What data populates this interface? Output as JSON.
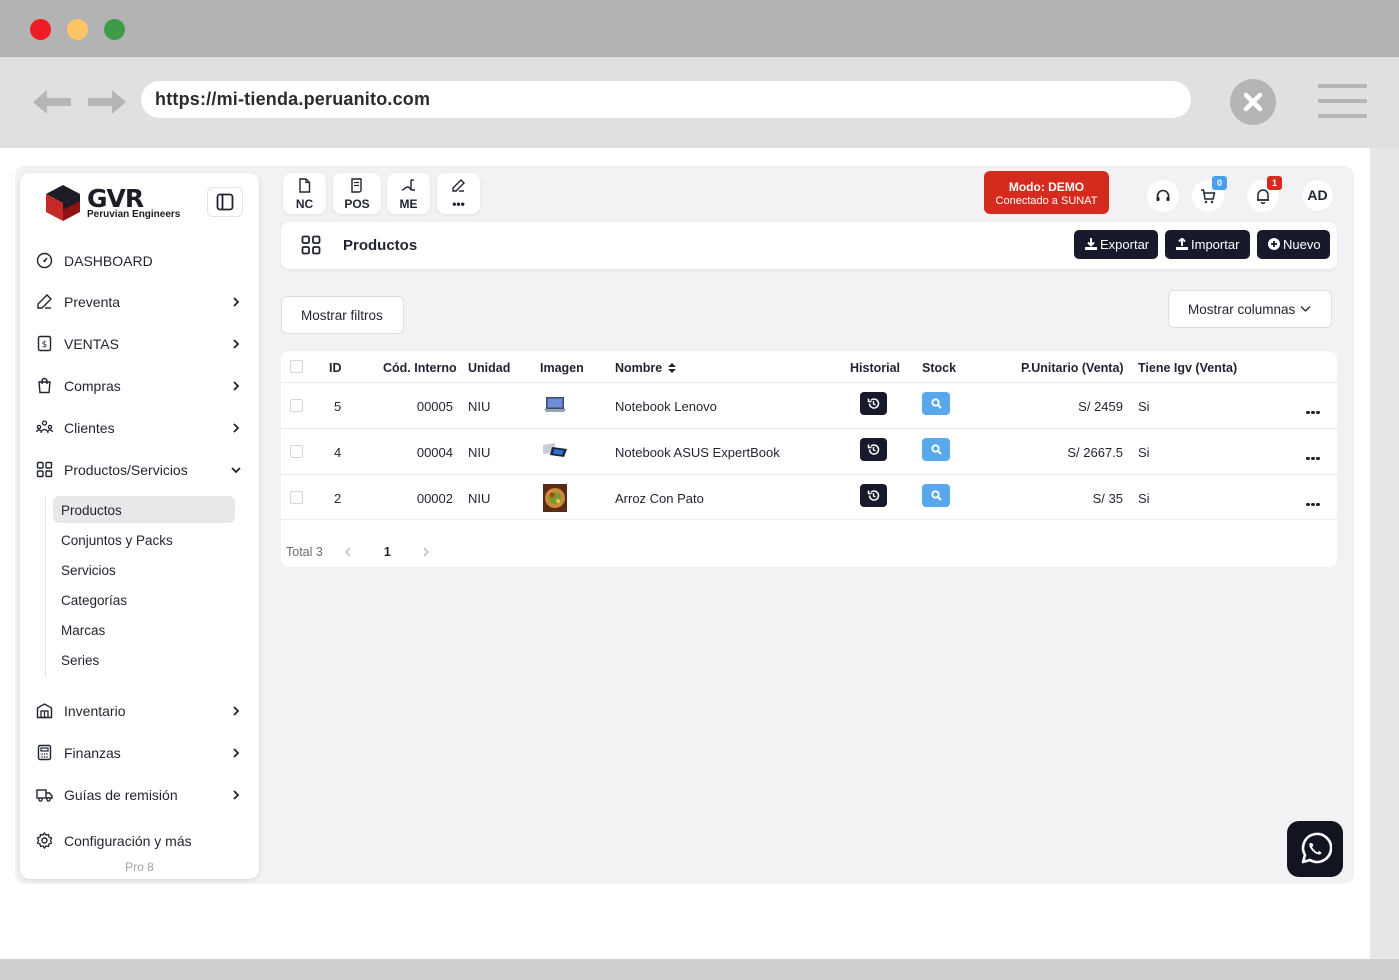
{
  "browser": {
    "url": "https://mi-tienda.peruanito.com",
    "traffic_lights": [
      "#ee1c25",
      "#fdc566",
      "#3e9b4a"
    ]
  },
  "sidebar": {
    "logo_title": "GVR",
    "logo_subtitle": "Peruvian Engineers",
    "items": [
      {
        "label": "DASHBOARD",
        "icon": "dashboard-gauge-icon",
        "chevron": false
      },
      {
        "label": "Preventa",
        "icon": "edit-icon",
        "chevron": true
      },
      {
        "label": "VENTAS",
        "icon": "receipt-icon",
        "chevron": true
      },
      {
        "label": "Compras",
        "icon": "shopping-bag-icon",
        "chevron": true
      },
      {
        "label": "Clientes",
        "icon": "users-icon",
        "chevron": true
      },
      {
        "label": "Productos/Servicios",
        "icon": "grid-icon",
        "chevron": "down"
      }
    ],
    "subitems": [
      {
        "label": "Productos",
        "active": true
      },
      {
        "label": "Conjuntos y Packs"
      },
      {
        "label": "Servicios"
      },
      {
        "label": "Categorías"
      },
      {
        "label": "Marcas"
      },
      {
        "label": "Series"
      }
    ],
    "bottom_items": [
      {
        "label": "Inventario",
        "icon": "warehouse-icon",
        "chevron": true
      },
      {
        "label": "Finanzas",
        "icon": "calculator-icon",
        "chevron": true
      },
      {
        "label": "Guías de remisión",
        "icon": "truck-icon",
        "chevron": true
      },
      {
        "label": "Configuración y más",
        "icon": "gear-icon",
        "chevron": false
      }
    ],
    "version": "Pro 8"
  },
  "quick_actions": [
    {
      "label": "NC",
      "icon": "document-icon"
    },
    {
      "label": "POS",
      "icon": "pos-receipt-icon"
    },
    {
      "label": "ME",
      "icon": "me-icon"
    },
    {
      "label": "•••",
      "icon": "edit-icon"
    }
  ],
  "demo_badge": {
    "line1": "Modo: DEMO",
    "line2": "Conectado a SUNAT",
    "color": "#d42b1e"
  },
  "header_icons": {
    "cart_count": "0",
    "cart_badge_color": "#4a9ff0",
    "notifications_count": "1",
    "notifications_badge_color": "#d42b1e",
    "avatar": "AD"
  },
  "page": {
    "title": "Productos",
    "export_label": "Exportar",
    "import_label": "Importar",
    "new_label": "Nuevo",
    "show_filters_label": "Mostrar filtros",
    "show_columns_label": "Mostrar columnas"
  },
  "table": {
    "columns": [
      "ID",
      "Cód. Interno",
      "Unidad",
      "Imagen",
      "Nombre",
      "Historial",
      "Stock",
      "P.Unitario (Venta)",
      "Tiene Igv (Venta)"
    ],
    "rows": [
      {
        "id": "5",
        "code": "00005",
        "unit": "NIU",
        "image": "laptop-thumbnail",
        "name": "Notebook Lenovo",
        "price": "S/ 2459",
        "igv": "Si"
      },
      {
        "id": "4",
        "code": "00004",
        "unit": "NIU",
        "image": "laptop-thumbnail",
        "name": "Notebook ASUS ExpertBook",
        "price": "S/ 2667.5",
        "igv": "Si"
      },
      {
        "id": "2",
        "code": "00002",
        "unit": "NIU",
        "image": "food-thumbnail",
        "name": "Arroz Con Pato",
        "price": "S/ 35",
        "igv": "Si"
      }
    ]
  },
  "pagination": {
    "total_label": "Total 3",
    "current_page": "1"
  }
}
